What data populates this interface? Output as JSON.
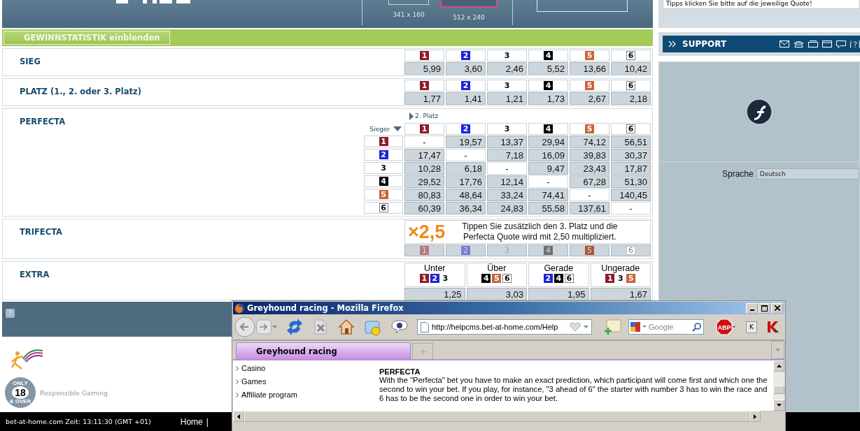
{
  "banner": {
    "thumbnails": [
      {
        "size": "341 x 160",
        "selected": false
      },
      {
        "size": "512 x 240",
        "selected": true
      }
    ]
  },
  "stats_button": "GEWINNSTATISTIK einblenden",
  "sieg": {
    "title": "SIEG",
    "runners": [
      {
        "number": "1",
        "color": "#8e1b2c",
        "kind": "solid"
      },
      {
        "number": "2",
        "color": "#1d23d8",
        "kind": "solid"
      },
      {
        "number": "3",
        "color": "#000000",
        "kind": "plain"
      },
      {
        "number": "4",
        "color": "#000000",
        "kind": "solid"
      },
      {
        "number": "5",
        "color": "#c8643a",
        "kind": "solid"
      },
      {
        "number": "6",
        "color": "#000000",
        "kind": "dotted"
      }
    ],
    "odds": [
      "5,99",
      "3,60",
      "2,46",
      "5,52",
      "13,66",
      "10,42"
    ]
  },
  "platz": {
    "title": "PLATZ",
    "note": "(1., 2. oder 3. Platz)",
    "runners": [
      {
        "number": "1",
        "color": "#8e1b2c",
        "kind": "solid"
      },
      {
        "number": "2",
        "color": "#1d23d8",
        "kind": "solid"
      },
      {
        "number": "3",
        "color": "#000000",
        "kind": "plain"
      },
      {
        "number": "4",
        "color": "#000000",
        "kind": "solid"
      },
      {
        "number": "5",
        "color": "#c8643a",
        "kind": "solid"
      },
      {
        "number": "6",
        "color": "#000000",
        "kind": "dotted"
      }
    ],
    "odds": [
      "1,77",
      "1,41",
      "1,21",
      "1,73",
      "2,67",
      "2,18"
    ]
  },
  "perfecta": {
    "title": "PERFECTA",
    "column_header": "2. Platz",
    "row_header": "Sieger",
    "columns": [
      {
        "number": "1",
        "color": "#8e1b2c",
        "kind": "solid"
      },
      {
        "number": "2",
        "color": "#1d23d8",
        "kind": "solid"
      },
      {
        "number": "3",
        "color": "#000000",
        "kind": "plain"
      },
      {
        "number": "4",
        "color": "#000000",
        "kind": "solid"
      },
      {
        "number": "5",
        "color": "#c8643a",
        "kind": "solid"
      },
      {
        "number": "6",
        "color": "#000000",
        "kind": "dotted"
      }
    ],
    "rows": [
      {
        "runner": {
          "number": "1",
          "color": "#8e1b2c",
          "kind": "solid"
        },
        "cells": [
          {
            "value": "-",
            "disabled": true
          },
          {
            "value": "19,57",
            "disabled": false
          },
          {
            "value": "13,37",
            "disabled": false
          },
          {
            "value": "29,94",
            "disabled": false
          },
          {
            "value": "74,12",
            "disabled": false
          },
          {
            "value": "56,51",
            "disabled": false
          }
        ]
      },
      {
        "runner": {
          "number": "2",
          "color": "#1d23d8",
          "kind": "solid"
        },
        "cells": [
          {
            "value": "17,47",
            "disabled": false
          },
          {
            "value": "-",
            "disabled": true
          },
          {
            "value": "7,18",
            "disabled": false
          },
          {
            "value": "16,09",
            "disabled": false
          },
          {
            "value": "39,83",
            "disabled": false
          },
          {
            "value": "30,37",
            "disabled": false
          }
        ]
      },
      {
        "runner": {
          "number": "3",
          "color": "#000000",
          "kind": "plain"
        },
        "cells": [
          {
            "value": "10,28",
            "disabled": false
          },
          {
            "value": "6,18",
            "disabled": false
          },
          {
            "value": "-",
            "disabled": true
          },
          {
            "value": "9,47",
            "disabled": false
          },
          {
            "value": "23,43",
            "disabled": false
          },
          {
            "value": "17,87",
            "disabled": false
          }
        ]
      },
      {
        "runner": {
          "number": "4",
          "color": "#000000",
          "kind": "solid"
        },
        "cells": [
          {
            "value": "29,52",
            "disabled": false
          },
          {
            "value": "17,76",
            "disabled": false
          },
          {
            "value": "12,14",
            "disabled": false
          },
          {
            "value": "-",
            "disabled": true
          },
          {
            "value": "67,28",
            "disabled": false
          },
          {
            "value": "51,30",
            "disabled": false
          }
        ]
      },
      {
        "runner": {
          "number": "5",
          "color": "#c8643a",
          "kind": "solid"
        },
        "cells": [
          {
            "value": "80,83",
            "disabled": false
          },
          {
            "value": "48,64",
            "disabled": false
          },
          {
            "value": "33,24",
            "disabled": false
          },
          {
            "value": "74,41",
            "disabled": false
          },
          {
            "value": "-",
            "disabled": true
          },
          {
            "value": "140,45",
            "disabled": false
          }
        ]
      },
      {
        "runner": {
          "number": "6",
          "color": "#000000",
          "kind": "dotted"
        },
        "cells": [
          {
            "value": "60,39",
            "disabled": false
          },
          {
            "value": "36,34",
            "disabled": false
          },
          {
            "value": "24,83",
            "disabled": false
          },
          {
            "value": "55,58",
            "disabled": false
          },
          {
            "value": "137,61",
            "disabled": false
          },
          {
            "value": "-",
            "disabled": true
          }
        ]
      }
    ]
  },
  "trifecta": {
    "title": "TRIFECTA",
    "multiplier": "×2,5",
    "text": "Tippen Sie zusätzlich den 3. Platz und die Perfecta Quote wird mit 2,50 multipliziert.",
    "runners": [
      {
        "number": "1",
        "color": "#b87880",
        "kind": "solid",
        "disabled": true
      },
      {
        "number": "2",
        "color": "#7a7ad8",
        "kind": "solid",
        "disabled": true
      },
      {
        "number": "3",
        "color": "#a0a0a0",
        "kind": "plain",
        "disabled": true
      },
      {
        "number": "4",
        "color": "#707070",
        "kind": "solid",
        "disabled": true
      },
      {
        "number": "5",
        "color": "#a85a3a",
        "kind": "solid",
        "disabled": true
      },
      {
        "number": "6",
        "color": "#808080",
        "kind": "dotted",
        "disabled": true
      }
    ]
  },
  "extra": {
    "title": "EXTRA",
    "options": [
      {
        "label": "Unter",
        "odds": "1,25",
        "runners": [
          {
            "number": "1",
            "color": "#8e1b2c",
            "kind": "solid"
          },
          {
            "number": "2",
            "color": "#1d23d8",
            "kind": "solid"
          },
          {
            "number": "3",
            "color": "#000000",
            "kind": "plain"
          }
        ]
      },
      {
        "label": "Über",
        "odds": "3,03",
        "runners": [
          {
            "number": "4",
            "color": "#000000",
            "kind": "solid"
          },
          {
            "number": "5",
            "color": "#c8643a",
            "kind": "solid"
          },
          {
            "number": "6",
            "color": "#000000",
            "kind": "dotted"
          }
        ]
      },
      {
        "label": "Gerade",
        "odds": "1,95",
        "runners": [
          {
            "number": "2",
            "color": "#1d23d8",
            "kind": "solid"
          },
          {
            "number": "4",
            "color": "#000000",
            "kind": "solid"
          },
          {
            "number": "6",
            "color": "#000000",
            "kind": "dotted"
          }
        ]
      },
      {
        "label": "Ungerade",
        "odds": "1,67",
        "runners": [
          {
            "number": "1",
            "color": "#8e1b2c",
            "kind": "solid"
          },
          {
            "number": "3",
            "color": "#000000",
            "kind": "plain"
          },
          {
            "number": "5",
            "color": "#c8643a",
            "kind": "solid"
          }
        ]
      }
    ]
  },
  "help_icon": "?",
  "age_badge": {
    "age": "18",
    "top": "ONLY",
    "bottom": "& OVER"
  },
  "responsible_gaming": "Responsible Gaming",
  "footer": {
    "status": "bet-at-home.com Zeit: 13:11:30 (GMT +01)",
    "link": "Home",
    "separator": "|"
  },
  "tip_text": "Tipps klicken Sie bitte auf die jeweilige Quote!",
  "support": {
    "title": "SUPPORT"
  },
  "language": {
    "label": "Sprache",
    "value": "Deutsch"
  },
  "browser": {
    "title": "Greyhound racing - Mozilla Firefox",
    "url": "http://helpcms.bet-at-home.com/Help",
    "search_placeholder": "Google",
    "adblock_label": "ABP",
    "k_button": "K",
    "tabs": [
      {
        "label": "Greyhound racing",
        "selected": true
      }
    ],
    "sidebar": [
      "Casino",
      "Games",
      "Affiliate program"
    ],
    "heading": "PERFECTA",
    "text": "With the \"Perfecta\" bet you have to make an exact prediction, which participant will come first and which one the second to win your bet. If you play, for instance, \"3 ahead of 6\" the starter with number 3 has to win the race and 6 has to be the second one in order to win your bet."
  }
}
